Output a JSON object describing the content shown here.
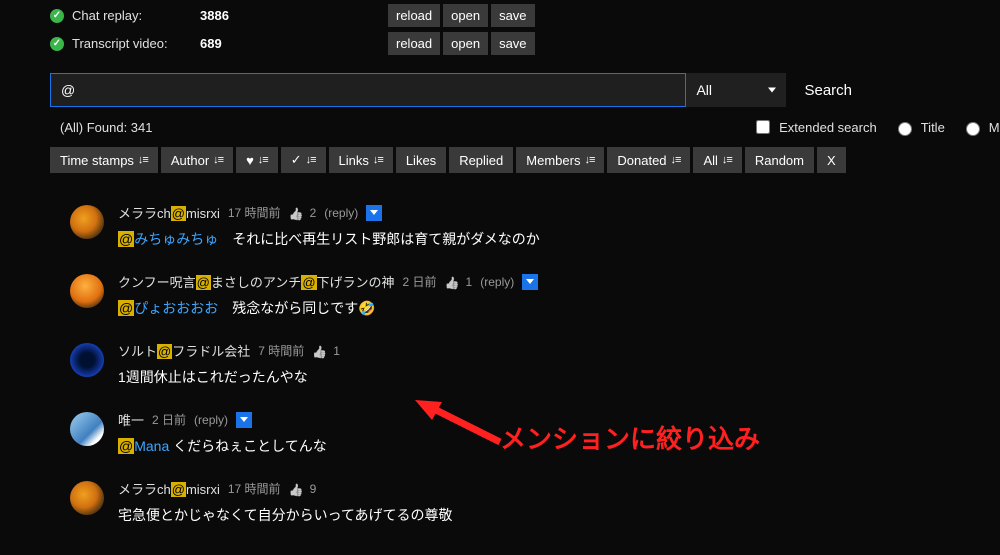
{
  "stats": {
    "chat_label": "Chat replay:",
    "chat_value": "3886",
    "transcript_label": "Transcript video:",
    "transcript_value": "689"
  },
  "buttons": {
    "reload": "reload",
    "open": "open",
    "save": "save"
  },
  "search": {
    "value": "@",
    "select": "All",
    "button": "Search"
  },
  "found_text": "(All) Found: 341",
  "ext_search": "Extended search",
  "title_opt": "Title",
  "main_opt": "Main",
  "q": "？",
  "filters": {
    "time": "Time stamps",
    "author": "Author",
    "links": "Links",
    "likes": "Likes",
    "replied": "Replied",
    "members": "Members",
    "donated": "Donated",
    "all": "All",
    "random": "Random",
    "x": "X"
  },
  "sort_glyph": "↓≡",
  "comments": [
    {
      "author_pre": "メララch",
      "author_hl": "@",
      "author_post": "misrxi",
      "time": "17 時間前",
      "likes": "2",
      "reply": "(reply)",
      "mention_hl": "@",
      "mention_post": "みちゅみちゅ",
      "text_after": "　それに比べ再生リスト野郎は育て親がダメなのか"
    },
    {
      "author_pre": "クンフー呪言",
      "author_hl1": "@",
      "author_mid": "まさしのアンチ",
      "author_hl2": "@",
      "author_post": "下げランの神",
      "time": "2 日前",
      "likes": "1",
      "reply": "(reply)",
      "mention_hl": "@",
      "mention_post": "ぴょおおおお",
      "text_after": "　残念ながら同じです🤣"
    },
    {
      "author_pre": "ソルト",
      "author_hl": "@",
      "author_post": "フラドル会社",
      "time": "7 時間前",
      "likes": "1",
      "text": "1週間休止はこれだったんやな"
    },
    {
      "author": "唯一",
      "time": "2 日前",
      "reply": "(reply)",
      "mention_hl": "@",
      "mention_post": "Mana",
      "text_after": " くだらねぇことしてんな"
    },
    {
      "author_pre": "メララch",
      "author_hl": "@",
      "author_post": "misrxi",
      "time": "17 時間前",
      "likes": "9",
      "text": "宅急便とかじゃなくて自分からいってあげてるの尊敬"
    }
  ],
  "annotation": "メンションに絞り込み"
}
